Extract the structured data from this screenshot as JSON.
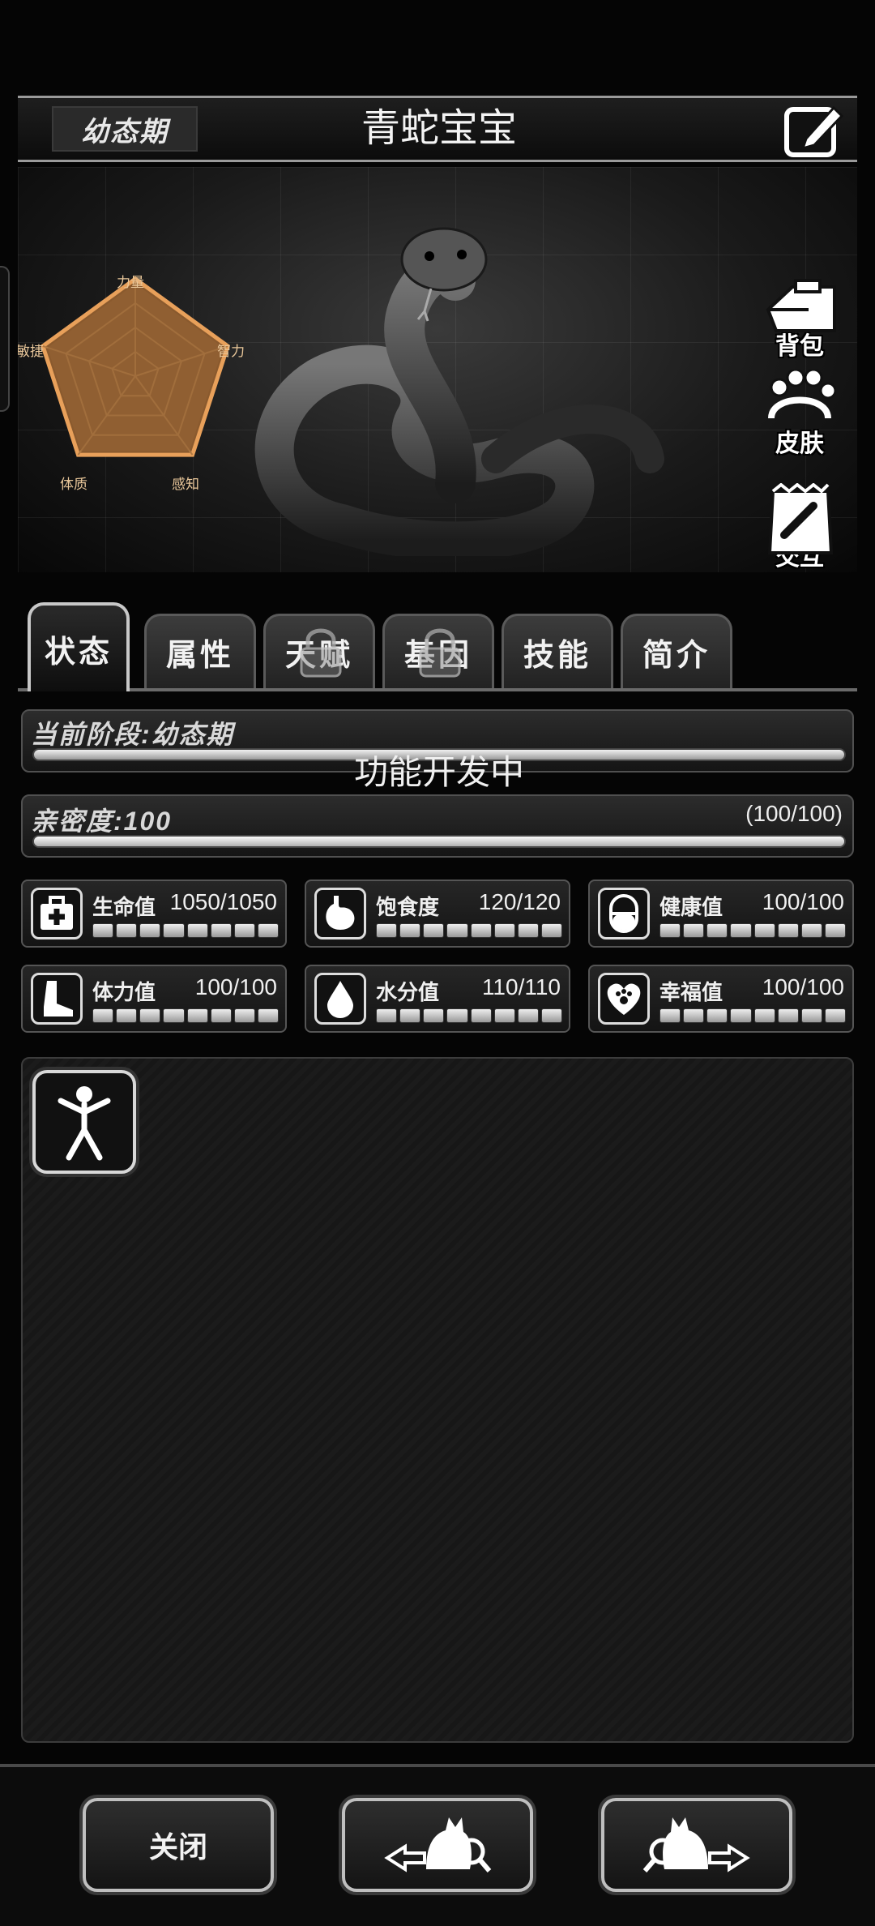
{
  "header": {
    "stage_badge": "幼态期",
    "pet_name": "青蛇宝宝"
  },
  "radar": {
    "labels": [
      "力量",
      "智力",
      "感知",
      "体质",
      "敏捷"
    ],
    "values": [
      0.95,
      0.95,
      0.95,
      0.95,
      0.95
    ],
    "fill_color": "#8a5a2e",
    "stroke_color": "#e8a05a"
  },
  "side_buttons": [
    {
      "label": "背包",
      "icon": "backpack-icon"
    },
    {
      "label": "皮肤",
      "icon": "paw-icon"
    },
    {
      "label": "交互",
      "icon": "treat-bag-icon"
    }
  ],
  "tabs": [
    {
      "label": "状态",
      "active": true,
      "locked": false
    },
    {
      "label": "属性",
      "active": false,
      "locked": false
    },
    {
      "label": "天赋",
      "active": false,
      "locked": true
    },
    {
      "label": "基因",
      "active": false,
      "locked": true
    },
    {
      "label": "技能",
      "active": false,
      "locked": false
    },
    {
      "label": "简介",
      "active": false,
      "locked": false
    }
  ],
  "stage_panel": {
    "label": "当前阶段:幼态期",
    "notice": "功能开发中"
  },
  "intimacy_panel": {
    "label": "亲密度:100",
    "value_text": "(100/100)",
    "progress": 1.0
  },
  "stats": [
    {
      "name": "生命值",
      "value": "1050/1050",
      "icon": "first-aid-icon",
      "progress": 1.0
    },
    {
      "name": "饱食度",
      "value": "120/120",
      "icon": "stomach-icon",
      "progress": 1.0
    },
    {
      "name": "健康值",
      "value": "100/100",
      "icon": "pill-icon",
      "progress": 1.0
    },
    {
      "name": "体力值",
      "value": "100/100",
      "icon": "foot-icon",
      "progress": 1.0
    },
    {
      "name": "水分值",
      "value": "110/110",
      "icon": "water-drop-icon",
      "progress": 1.0
    },
    {
      "name": "幸福值",
      "value": "100/100",
      "icon": "heart-paw-icon",
      "progress": 1.0
    }
  ],
  "bottom": {
    "close_label": "关闭"
  },
  "colors": {
    "accent_orange": "#e8a05a",
    "panel_border": "#505050",
    "background": "#050505"
  }
}
